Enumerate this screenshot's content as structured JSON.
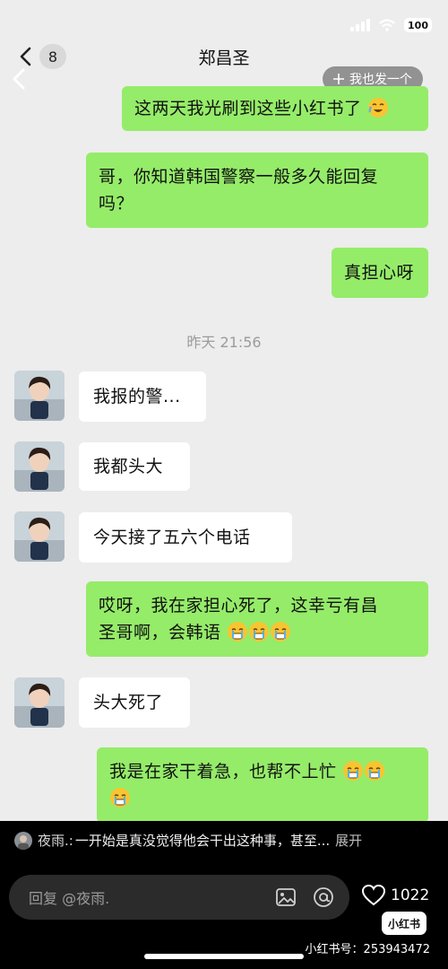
{
  "status_bar": {
    "battery": "100"
  },
  "nav": {
    "back_count": "8",
    "title": "郑昌圣"
  },
  "overlay": {
    "me_too_label": "我也发一个"
  },
  "messages": [
    {
      "side": "right",
      "text": "这两天我光刷到这些小红书了"
    },
    {
      "side": "right",
      "text_line1": "哥，你知道韩国警察一般多久能回复",
      "text_line2": "吗？"
    },
    {
      "side": "right",
      "text": "真担心呀"
    },
    {
      "type": "timestamp",
      "text": "昨天 21:56"
    },
    {
      "side": "left",
      "text": "我报的警..."
    },
    {
      "side": "left",
      "text": "我都头大"
    },
    {
      "side": "left",
      "text": "今天接了五六个电话"
    },
    {
      "side": "right",
      "text_line1": "哎呀，我在家担心死了，这幸亏有昌",
      "text_line2": "圣哥啊，会韩语"
    },
    {
      "side": "left",
      "text": "头大死了"
    },
    {
      "side": "right",
      "text_line1": "我是在家干着急，也帮不上忙"
    }
  ],
  "comment": {
    "author": "夜雨.:",
    "text": "一开始是真没觉得他会干出这种事，甚至...",
    "expand": "展开"
  },
  "reply": {
    "placeholder": "回复 @夜雨."
  },
  "likes": {
    "count": "1022"
  },
  "brand": {
    "logo": "小红书",
    "id_text": "小红书号：253943472"
  },
  "colors": {
    "bubble_green": "#95ec69",
    "chat_bg": "#ededed",
    "bottom_bar": "#000000"
  },
  "icons": [
    "back-chevron-icon",
    "signal-icon",
    "wifi-icon",
    "battery-icon",
    "plus-icon",
    "laugh-cry-emoji",
    "crying-emoji",
    "image-icon",
    "at-icon",
    "heart-icon"
  ]
}
